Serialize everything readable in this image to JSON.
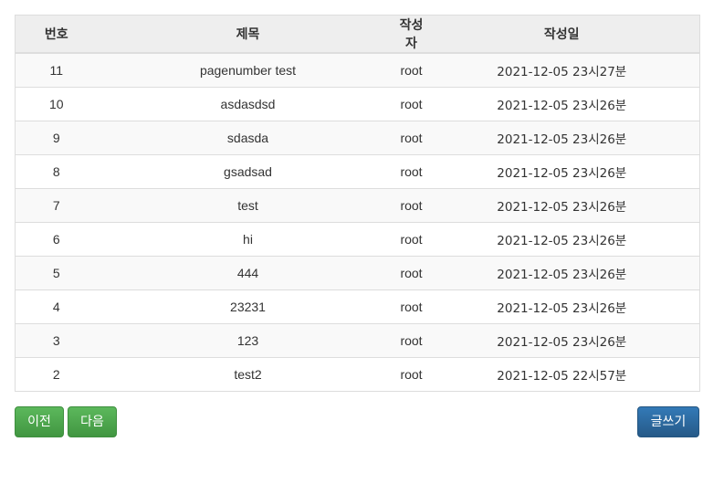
{
  "table": {
    "headers": [
      "번호",
      "제목",
      "작성자",
      "작성일"
    ],
    "rows": [
      {
        "no": "11",
        "title": "pagenumber test",
        "author": "root",
        "date": "2021-12-05 23시27분"
      },
      {
        "no": "10",
        "title": "asdasdsd",
        "author": "root",
        "date": "2021-12-05 23시26분"
      },
      {
        "no": "9",
        "title": "sdasda",
        "author": "root",
        "date": "2021-12-05 23시26분"
      },
      {
        "no": "8",
        "title": "gsadsad",
        "author": "root",
        "date": "2021-12-05 23시26분"
      },
      {
        "no": "7",
        "title": "test",
        "author": "root",
        "date": "2021-12-05 23시26분"
      },
      {
        "no": "6",
        "title": "hi",
        "author": "root",
        "date": "2021-12-05 23시26분"
      },
      {
        "no": "5",
        "title": "444",
        "author": "root",
        "date": "2021-12-05 23시26분"
      },
      {
        "no": "4",
        "title": "23231",
        "author": "root",
        "date": "2021-12-05 23시26분"
      },
      {
        "no": "3",
        "title": "123",
        "author": "root",
        "date": "2021-12-05 23시26분"
      },
      {
        "no": "2",
        "title": "test2",
        "author": "root",
        "date": "2021-12-05 22시57분"
      }
    ]
  },
  "buttons": {
    "prev_label": "이전",
    "next_label": "다음",
    "write_label": "글쓰기"
  },
  "colors": {
    "header_bg": "#eeeeee",
    "stripe_bg": "#f9f9f9",
    "border": "#dddddd",
    "success": "#5cb85c",
    "primary": "#337ab7"
  }
}
